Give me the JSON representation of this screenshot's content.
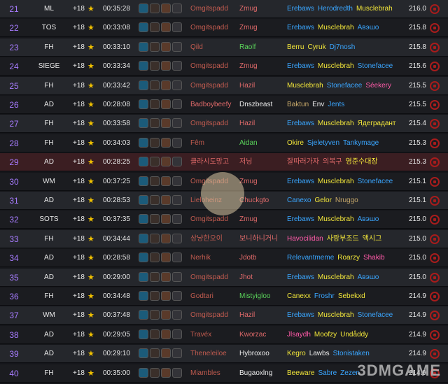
{
  "colors": {
    "rank": "#a77cff",
    "tank": "#c15b4f",
    "tank_alt": "#e06a6a",
    "healer": "#5ad35a",
    "dps_blue": "#3aa6ff",
    "dps_yellow": "#f2e63a",
    "dps_pink": "#ff5aa8",
    "dps_tan": "#c8a96a",
    "highlight_row": "#3b1e22"
  },
  "icons": [
    "star-icon",
    "affix-icon",
    "horde-faction-icon"
  ],
  "watermark": "3DMGAME",
  "rows": [
    {
      "rank": "21",
      "dungeon": "ML",
      "level": "+18",
      "time": "00:35:28",
      "tank": {
        "name": "Omgitspadd",
        "color": "#c15b4f"
      },
      "healer": {
        "name": "Zmug",
        "color": "#e06a6a"
      },
      "dps": [
        {
          "name": "Erebaws",
          "color": "#3aa6ff"
        },
        {
          "name": "Herodredth",
          "color": "#3aa6ff"
        },
        {
          "name": "Musclebrah",
          "color": "#f2e63a"
        }
      ],
      "score": "216.0"
    },
    {
      "rank": "22",
      "dungeon": "TOS",
      "level": "+18",
      "time": "00:33:08",
      "tank": {
        "name": "Omgitspadd",
        "color": "#c15b4f"
      },
      "healer": {
        "name": "Zmug",
        "color": "#e06a6a"
      },
      "dps": [
        {
          "name": "Erebaws",
          "color": "#3aa6ff"
        },
        {
          "name": "Musclebrah",
          "color": "#f2e63a"
        },
        {
          "name": "Aвэшо",
          "color": "#3aa6ff"
        }
      ],
      "score": "215.8"
    },
    {
      "rank": "23",
      "dungeon": "FH",
      "level": "+18",
      "time": "00:33:10",
      "tank": {
        "name": "Qild",
        "color": "#c15b4f"
      },
      "healer": {
        "name": "Raolf",
        "color": "#5ad35a"
      },
      "dps": [
        {
          "name": "Berru",
          "color": "#f2e63a"
        },
        {
          "name": "Cyruk",
          "color": "#f2e63a"
        },
        {
          "name": "Dj7nosh",
          "color": "#3aa6ff"
        }
      ],
      "score": "215.8"
    },
    {
      "rank": "24",
      "dungeon": "SIEGE",
      "level": "+18",
      "time": "00:33:34",
      "tank": {
        "name": "Omgitspadd",
        "color": "#c15b4f"
      },
      "healer": {
        "name": "Zmug",
        "color": "#e06a6a"
      },
      "dps": [
        {
          "name": "Erebaws",
          "color": "#3aa6ff"
        },
        {
          "name": "Musclebrah",
          "color": "#f2e63a"
        },
        {
          "name": "Stonefacee",
          "color": "#3aa6ff"
        }
      ],
      "score": "215.6"
    },
    {
      "rank": "25",
      "dungeon": "FH",
      "level": "+18",
      "time": "00:33:42",
      "tank": {
        "name": "Omgitspadd",
        "color": "#c15b4f"
      },
      "healer": {
        "name": "Hazil",
        "color": "#e06a6a"
      },
      "dps": [
        {
          "name": "Musclebrah",
          "color": "#f2e63a"
        },
        {
          "name": "Stonefacee",
          "color": "#3aa6ff"
        },
        {
          "name": "Séekery",
          "color": "#ff5aa8"
        }
      ],
      "score": "215.5"
    },
    {
      "rank": "26",
      "dungeon": "AD",
      "level": "+18",
      "time": "00:28:08",
      "tank": {
        "name": "Badboybeefy",
        "color": "#e06a6a"
      },
      "healer": {
        "name": "Dnszbeast",
        "color": "#ececec"
      },
      "dps": [
        {
          "name": "Baktun",
          "color": "#c8a96a"
        },
        {
          "name": "Env",
          "color": "#ececec"
        },
        {
          "name": "Jents",
          "color": "#3aa6ff"
        }
      ],
      "score": "215.5"
    },
    {
      "rank": "27",
      "dungeon": "FH",
      "level": "+18",
      "time": "00:33:58",
      "tank": {
        "name": "Omgitspadd",
        "color": "#c15b4f"
      },
      "healer": {
        "name": "Hazil",
        "color": "#e06a6a"
      },
      "dps": [
        {
          "name": "Erebaws",
          "color": "#3aa6ff"
        },
        {
          "name": "Musclebrah",
          "color": "#f2e63a"
        },
        {
          "name": "Ядеградант",
          "color": "#f2e63a"
        }
      ],
      "score": "215.4"
    },
    {
      "rank": "28",
      "dungeon": "FH",
      "level": "+18",
      "time": "00:34:03",
      "tank": {
        "name": "Fêm",
        "color": "#c15b4f"
      },
      "healer": {
        "name": "Aidan",
        "color": "#5ad35a"
      },
      "dps": [
        {
          "name": "Okire",
          "color": "#f2e63a"
        },
        {
          "name": "Sjeletyven",
          "color": "#3aa6ff"
        },
        {
          "name": "Tankymage",
          "color": "#3aa6ff"
        }
      ],
      "score": "215.3"
    },
    {
      "rank": "29",
      "dungeon": "AD",
      "level": "+18",
      "time": "00:28:25",
      "tank": {
        "name": "클라시도망고",
        "color": "#e06a6a"
      },
      "healer": {
        "name": "저닝",
        "color": "#e06a6a"
      },
      "dps": [
        {
          "name": "잘따러가자",
          "color": "#e06a6a"
        },
        {
          "name": "의복구",
          "color": "#e06a6a"
        },
        {
          "name": "영준수대장",
          "color": "#f2e63a"
        }
      ],
      "score": "215.3",
      "highlight": true
    },
    {
      "rank": "30",
      "dungeon": "WM",
      "level": "+18",
      "time": "00:37:25",
      "tank": {
        "name": "Omgitspadd",
        "color": "#c15b4f"
      },
      "healer": {
        "name": "Zmug",
        "color": "#e06a6a"
      },
      "dps": [
        {
          "name": "Erebaws",
          "color": "#3aa6ff"
        },
        {
          "name": "Musclebrah",
          "color": "#f2e63a"
        },
        {
          "name": "Stonefacee",
          "color": "#3aa6ff"
        }
      ],
      "score": "215.1"
    },
    {
      "rank": "31",
      "dungeon": "AD",
      "level": "+18",
      "time": "00:28:53",
      "tank": {
        "name": "Lieloheinz",
        "color": "#c15b4f"
      },
      "healer": {
        "name": "Chuckgto",
        "color": "#e06a6a"
      },
      "dps": [
        {
          "name": "Canexo",
          "color": "#3aa6ff"
        },
        {
          "name": "Gelor",
          "color": "#f2e63a"
        },
        {
          "name": "Nruggo",
          "color": "#c8a96a"
        }
      ],
      "score": "215.1"
    },
    {
      "rank": "32",
      "dungeon": "SOTS",
      "level": "+18",
      "time": "00:37:35",
      "tank": {
        "name": "Omgitspadd",
        "color": "#c15b4f"
      },
      "healer": {
        "name": "Zmug",
        "color": "#e06a6a"
      },
      "dps": [
        {
          "name": "Erebaws",
          "color": "#3aa6ff"
        },
        {
          "name": "Musclebrah",
          "color": "#f2e63a"
        },
        {
          "name": "Aвэшо",
          "color": "#3aa6ff"
        }
      ],
      "score": "215.0"
    },
    {
      "rank": "33",
      "dungeon": "FH",
      "level": "+18",
      "time": "00:34:44",
      "tank": {
        "name": "상냥한오이",
        "color": "#c15b4f"
      },
      "healer": {
        "name": "보니하니거니",
        "color": "#e06a6a"
      },
      "dps": [
        {
          "name": "Havocilidan",
          "color": "#ff5aa8"
        },
        {
          "name": "사랑부조드",
          "color": "#f2e63a"
        },
        {
          "name": "액시그",
          "color": "#f2e63a"
        }
      ],
      "score": "215.0"
    },
    {
      "rank": "34",
      "dungeon": "AD",
      "level": "+18",
      "time": "00:28:58",
      "tank": {
        "name": "Nerhik",
        "color": "#c15b4f"
      },
      "healer": {
        "name": "Jdotb",
        "color": "#e06a6a"
      },
      "dps": [
        {
          "name": "Relevantmeme",
          "color": "#3aa6ff"
        },
        {
          "name": "Roarzy",
          "color": "#f2e63a"
        },
        {
          "name": "Shakib",
          "color": "#ff5aa8"
        }
      ],
      "score": "215.0"
    },
    {
      "rank": "35",
      "dungeon": "AD",
      "level": "+18",
      "time": "00:29:00",
      "tank": {
        "name": "Omgitspadd",
        "color": "#c15b4f"
      },
      "healer": {
        "name": "Jhot",
        "color": "#e06a6a"
      },
      "dps": [
        {
          "name": "Erebaws",
          "color": "#3aa6ff"
        },
        {
          "name": "Musclebrah",
          "color": "#f2e63a"
        },
        {
          "name": "Aвэшо",
          "color": "#3aa6ff"
        }
      ],
      "score": "215.0"
    },
    {
      "rank": "36",
      "dungeon": "FH",
      "level": "+18",
      "time": "00:34:48",
      "tank": {
        "name": "Godtari",
        "color": "#c15b4f"
      },
      "healer": {
        "name": "Mistyigloo",
        "color": "#5ad35a"
      },
      "dps": [
        {
          "name": "Canexx",
          "color": "#f2e63a"
        },
        {
          "name": "Froshr",
          "color": "#3aa6ff"
        },
        {
          "name": "Sebekxd",
          "color": "#f2e63a"
        }
      ],
      "score": "214.9"
    },
    {
      "rank": "37",
      "dungeon": "WM",
      "level": "+18",
      "time": "00:37:48",
      "tank": {
        "name": "Omgitspadd",
        "color": "#c15b4f"
      },
      "healer": {
        "name": "Hazil",
        "color": "#e06a6a"
      },
      "dps": [
        {
          "name": "Erebaws",
          "color": "#3aa6ff"
        },
        {
          "name": "Musclebrah",
          "color": "#f2e63a"
        },
        {
          "name": "Stonefacee",
          "color": "#3aa6ff"
        }
      ],
      "score": "214.9"
    },
    {
      "rank": "38",
      "dungeon": "AD",
      "level": "+18",
      "time": "00:29:05",
      "tank": {
        "name": "Travéx",
        "color": "#c15b4f"
      },
      "healer": {
        "name": "Kworzac",
        "color": "#e06a6a"
      },
      "dps": [
        {
          "name": "Jlsaydh",
          "color": "#ff5aa8"
        },
        {
          "name": "Moofzy",
          "color": "#f2e63a"
        },
        {
          "name": "Undåddy",
          "color": "#f2e63a"
        }
      ],
      "score": "214.9"
    },
    {
      "rank": "39",
      "dungeon": "AD",
      "level": "+18",
      "time": "00:29:10",
      "tank": {
        "name": "Theneleiloe",
        "color": "#c15b4f"
      },
      "healer": {
        "name": "Hybroxoo",
        "color": "#ececec"
      },
      "dps": [
        {
          "name": "Kegro",
          "color": "#f2e63a"
        },
        {
          "name": "Lawbs",
          "color": "#ececec"
        },
        {
          "name": "Stonistaken",
          "color": "#3aa6ff"
        }
      ],
      "score": "214.9"
    },
    {
      "rank": "40",
      "dungeon": "FH",
      "level": "+18",
      "time": "00:35:00",
      "tank": {
        "name": "Miambles",
        "color": "#c15b4f"
      },
      "healer": {
        "name": "Bugaoxlng",
        "color": "#ececec"
      },
      "dps": [
        {
          "name": "Beeware",
          "color": "#f2e63a"
        },
        {
          "name": "Sabre",
          "color": "#3aa6ff"
        },
        {
          "name": "Zezen",
          "color": "#3aa6ff"
        }
      ],
      "score": "214.9"
    }
  ]
}
